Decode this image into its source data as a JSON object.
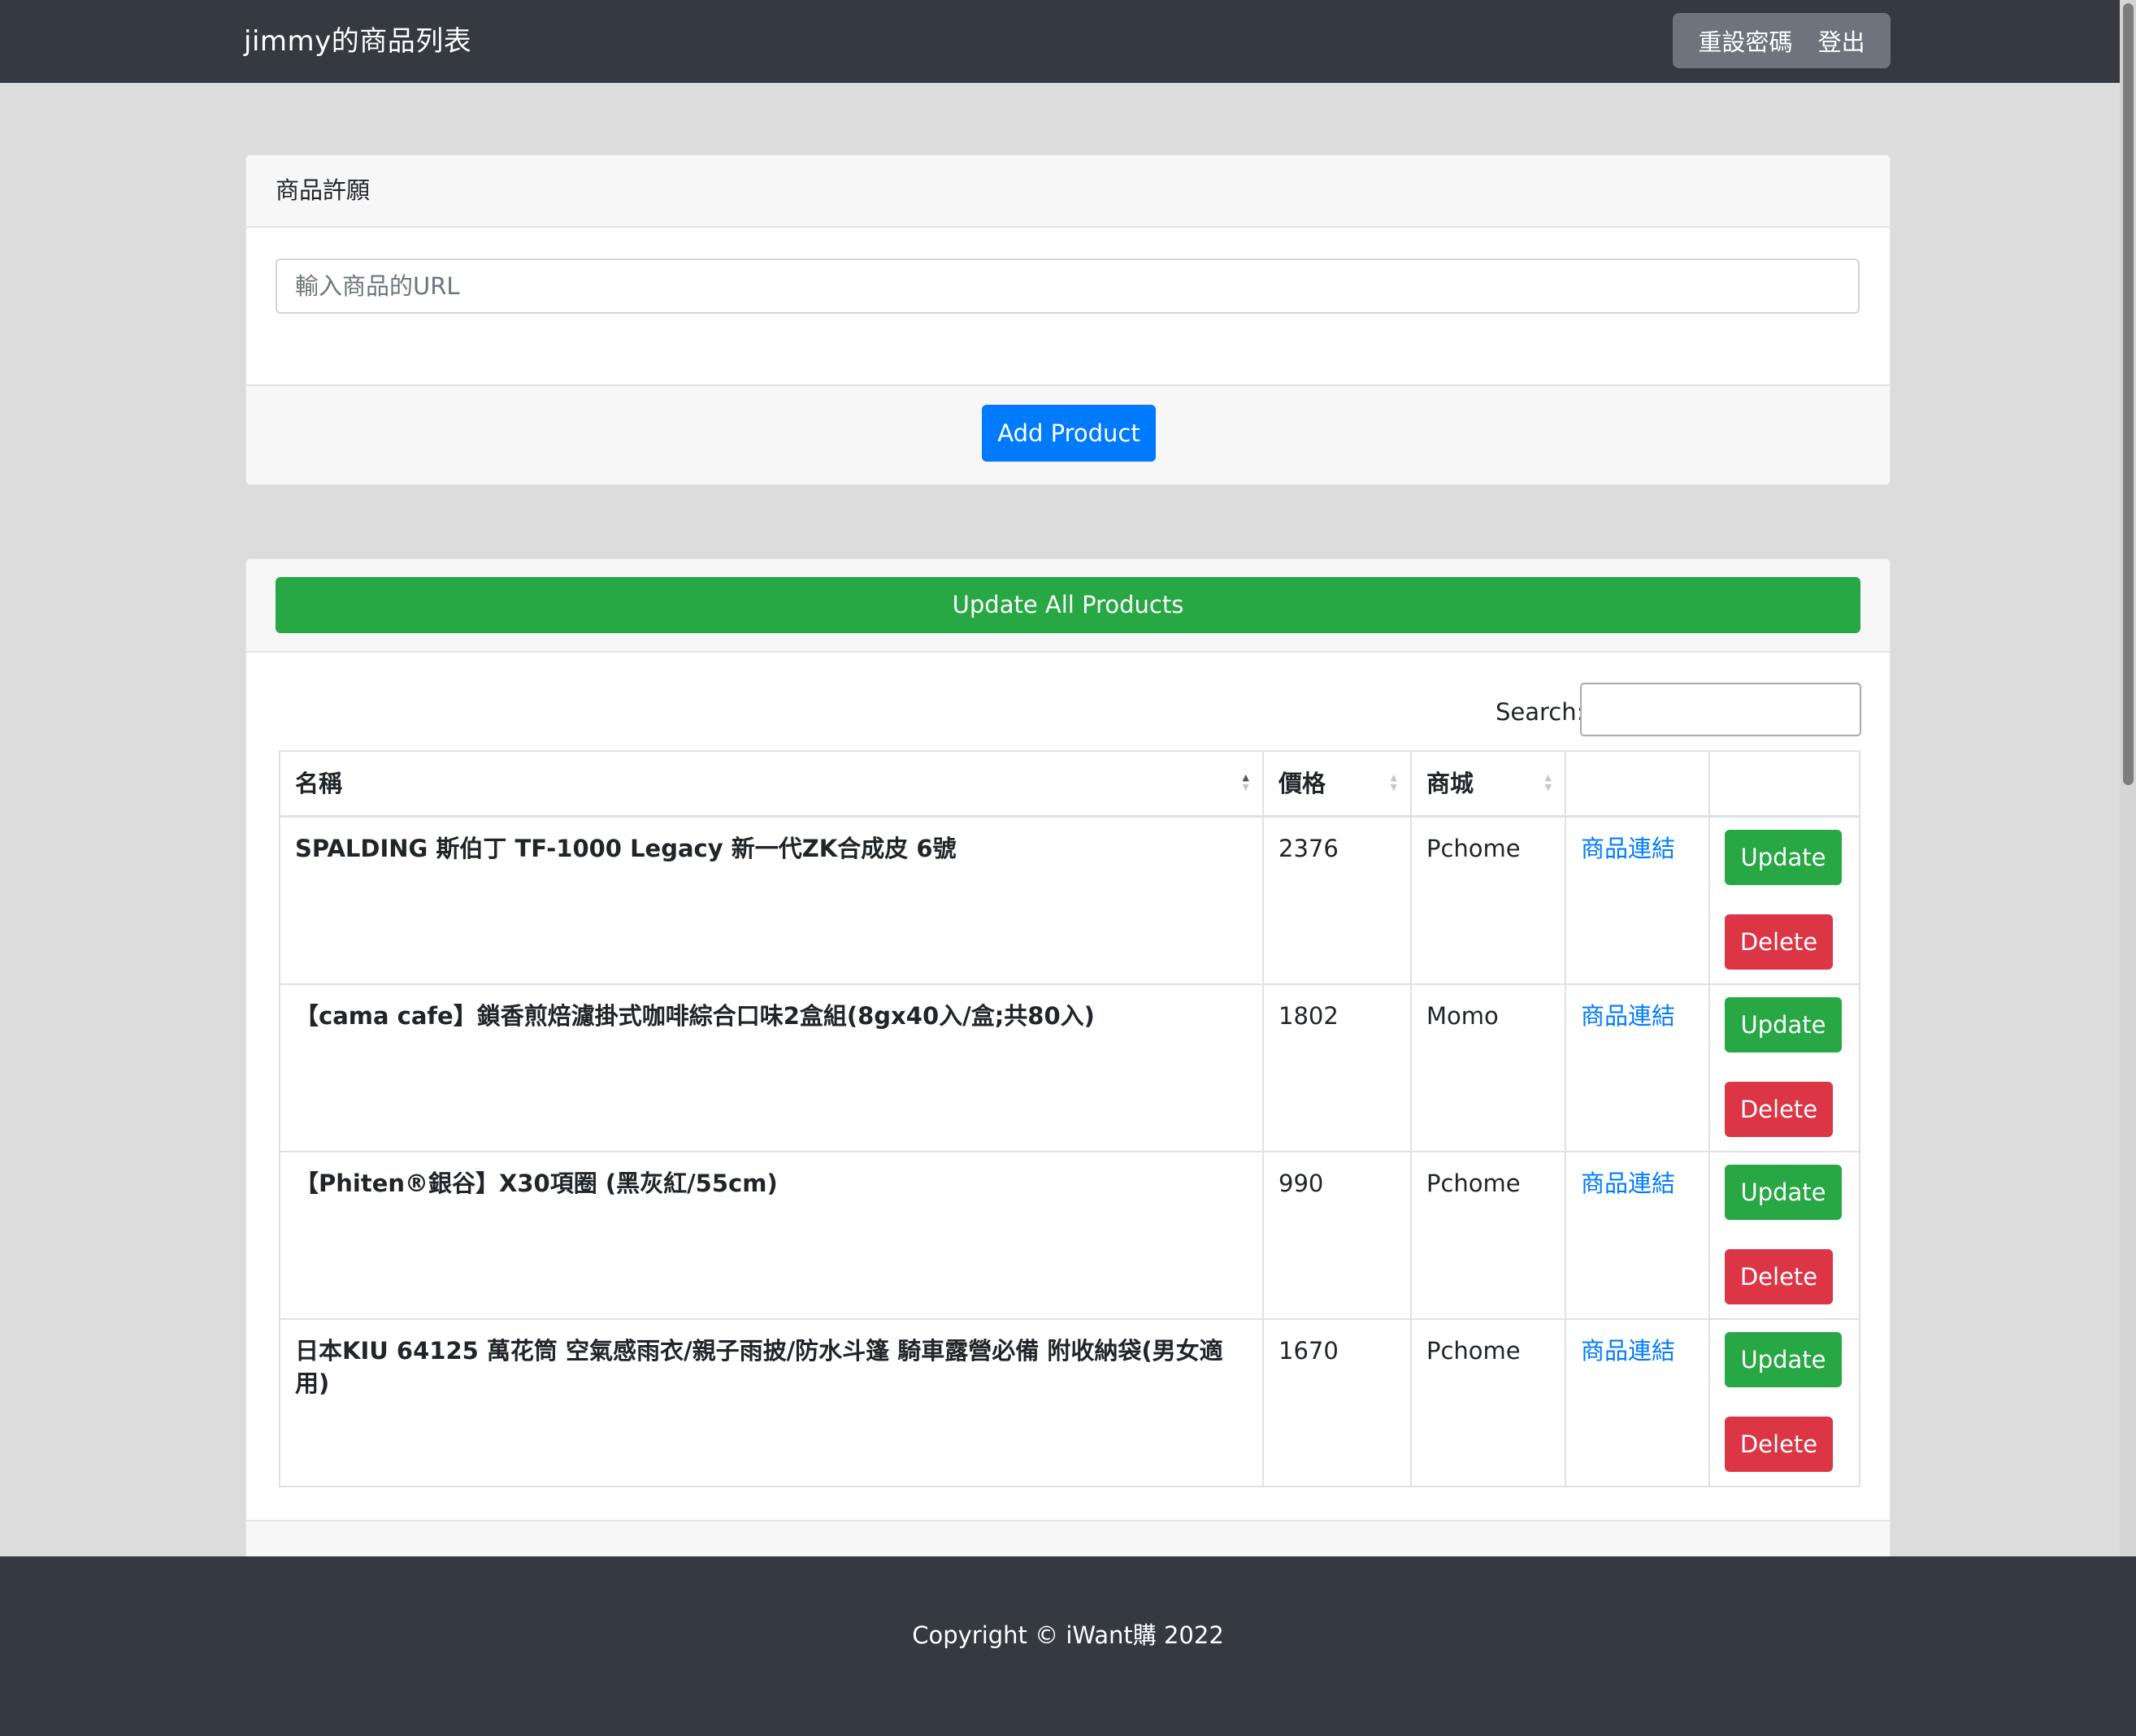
{
  "navbar": {
    "brand": "jimmy的商品列表",
    "reset_password": "重設密碼",
    "logout": "登出"
  },
  "wishlist_card": {
    "header": "商品許願",
    "url_placeholder": "輸入商品的URL",
    "add_button": "Add Product"
  },
  "products_card": {
    "update_all_button": "Update All Products",
    "search_label": "Search:",
    "search_value": "",
    "columns": [
      "名稱",
      "價格",
      "商城",
      "",
      ""
    ],
    "link_label": "商品連結",
    "update_label": "Update",
    "delete_label": "Delete",
    "rows": [
      {
        "name": "SPALDING 斯伯丁 TF-1000 Legacy 新一代ZK合成皮 6號",
        "price": "2376",
        "store": "Pchome"
      },
      {
        "name": "【cama cafe】鎖香煎焙濾掛式咖啡綜合口味2盒組(8gx40入/盒;共80入)",
        "price": "1802",
        "store": "Momo"
      },
      {
        "name": "【Phiten®銀谷】X30項圈 (黑灰紅/55cm)",
        "price": "990",
        "store": "Pchome"
      },
      {
        "name": "日本KIU 64125 萬花筒 空氣感雨衣/親子雨披/防水斗篷 騎車露營必備 附收納袋(男女適用)",
        "price": "1670",
        "store": "Pchome"
      }
    ]
  },
  "footer": {
    "copyright": "Copyright © iWant購 2022"
  },
  "colors": {
    "navbar_bg": "#343a40",
    "primary": "#007bff",
    "success": "#28a745",
    "danger": "#dc3545",
    "secondary": "#6c757d"
  }
}
